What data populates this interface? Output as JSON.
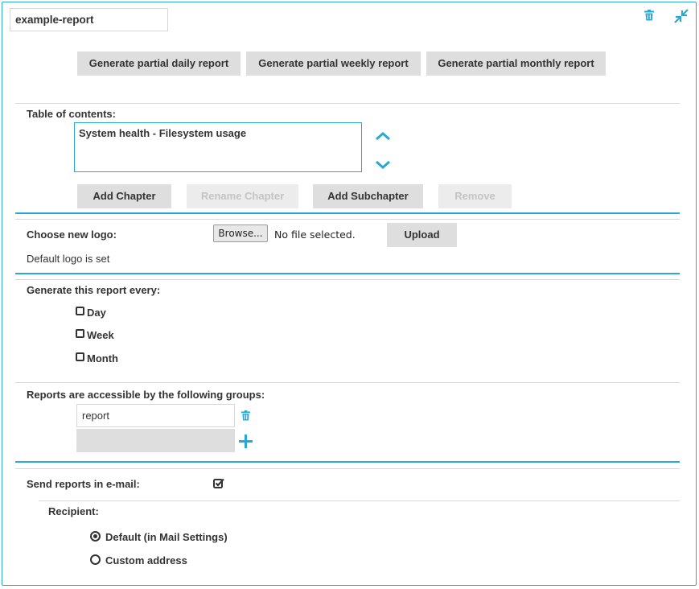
{
  "report": {
    "name": "example-report"
  },
  "toolbar": {
    "delete_icon": "trash-icon",
    "collapse_icon": "collapse-arrows-icon"
  },
  "generate": {
    "daily": "Generate partial daily report",
    "weekly": "Generate partial weekly report",
    "monthly": "Generate partial monthly report"
  },
  "toc": {
    "label": "Table of contents:",
    "items": [
      "System health - Filesystem usage"
    ],
    "add_chapter": "Add Chapter",
    "rename_chapter": "Rename Chapter",
    "add_subchapter": "Add Subchapter",
    "remove": "Remove"
  },
  "logo": {
    "label": "Choose new logo:",
    "browse": "Browse...",
    "file_status": "No file selected.",
    "upload": "Upload",
    "status": "Default logo is set"
  },
  "schedule": {
    "label": "Generate this report every:",
    "options": [
      {
        "label": "Day",
        "checked": false
      },
      {
        "label": "Week",
        "checked": false
      },
      {
        "label": "Month",
        "checked": false
      }
    ]
  },
  "groups": {
    "label": "Reports are accessible by the following groups:",
    "items": [
      "report"
    ]
  },
  "email": {
    "label": "Send reports in e-mail:",
    "enabled": true,
    "recipient_label": "Recipient:",
    "recipient_options": [
      {
        "label": "Default (in Mail Settings)",
        "selected": true
      },
      {
        "label": "Custom address",
        "selected": false
      }
    ]
  },
  "colors": {
    "accent": "#29a8d6",
    "button_bg": "#dedede",
    "text": "#333333"
  }
}
